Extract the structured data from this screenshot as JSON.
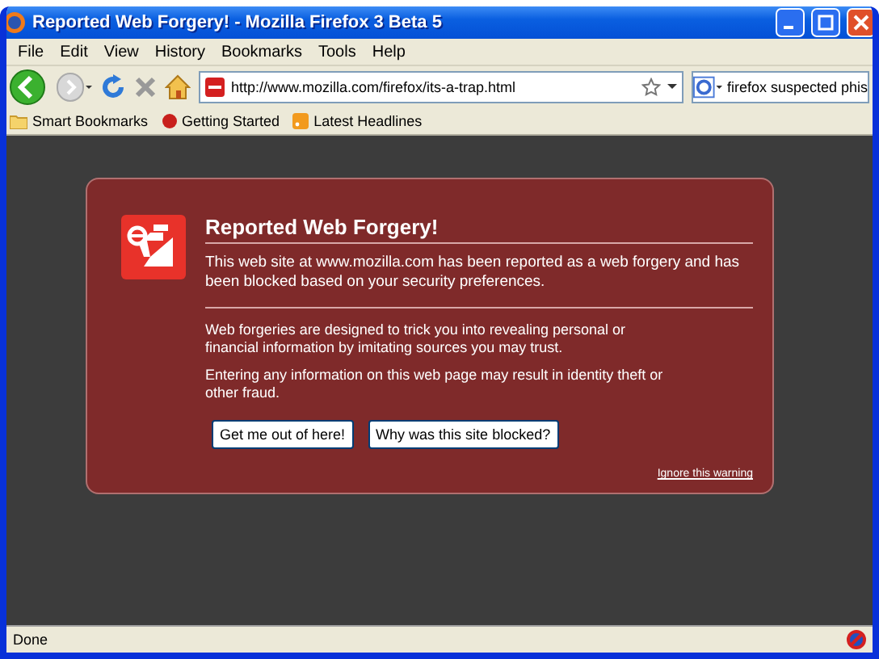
{
  "window": {
    "title": "Reported Web Forgery! - Mozilla Firefox 3 Beta 5"
  },
  "menu": [
    "File",
    "Edit",
    "View",
    "History",
    "Bookmarks",
    "Tools",
    "Help"
  ],
  "toolbar": {
    "url": "http://www.mozilla.com/firefox/its-a-trap.html",
    "search": "firefox suspected phis"
  },
  "bookmarks": [
    {
      "label": "Smart Bookmarks",
      "kind": "folder"
    },
    {
      "label": "Getting Started",
      "kind": "page"
    },
    {
      "label": "Latest Headlines",
      "kind": "feed"
    }
  ],
  "error": {
    "title": "Reported Web Forgery!",
    "lead": "This web site at www.mozilla.com has been reported as a web forgery and has been blocked based on your security preferences.",
    "paragraphs": [
      "Web forgeries are designed to trick you into revealing personal or financial information by imitating sources you may trust.",
      "Entering any information on this web page may result in identity theft or other fraud."
    ],
    "buttons": [
      "Get me out of here!",
      "Why was this site blocked?"
    ],
    "ignore_link": "Ignore this warning"
  },
  "status_bar": {
    "text": "Done"
  }
}
